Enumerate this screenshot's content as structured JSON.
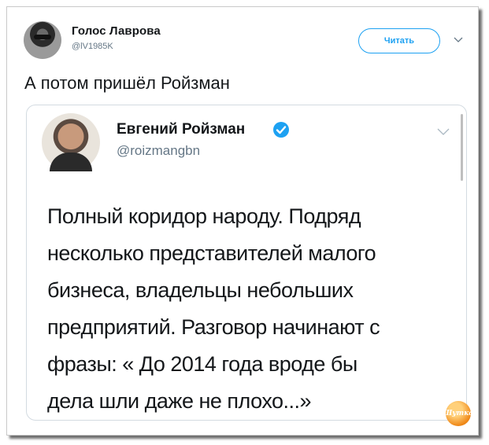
{
  "tweet": {
    "author_name": "Голос Лаврова",
    "author_handle": "@lV1985K",
    "follow_label": "Читать",
    "text": "А потом пришёл Ройзман"
  },
  "quoted_tweet": {
    "author_name": "Евгений Ройзман",
    "author_handle": "@roizmangbn",
    "verified": true,
    "text_lines": [
      "Полный коридор народу. Подряд",
      "несколько представителей малого",
      "бизнеса, владельцы небольших",
      "предприятий. Разговор начинают с",
      "фразы: « До 2014 года вроде бы",
      "дела шли даже не плохо...»"
    ]
  },
  "watermark": {
    "text": "Шутка"
  },
  "colors": {
    "accent": "#1da1f2",
    "text": "#14171a",
    "muted": "#657786",
    "border": "#d3dbe1"
  },
  "icons": {
    "menu": "chevron-down-icon",
    "verified": "verified-badge-icon"
  }
}
